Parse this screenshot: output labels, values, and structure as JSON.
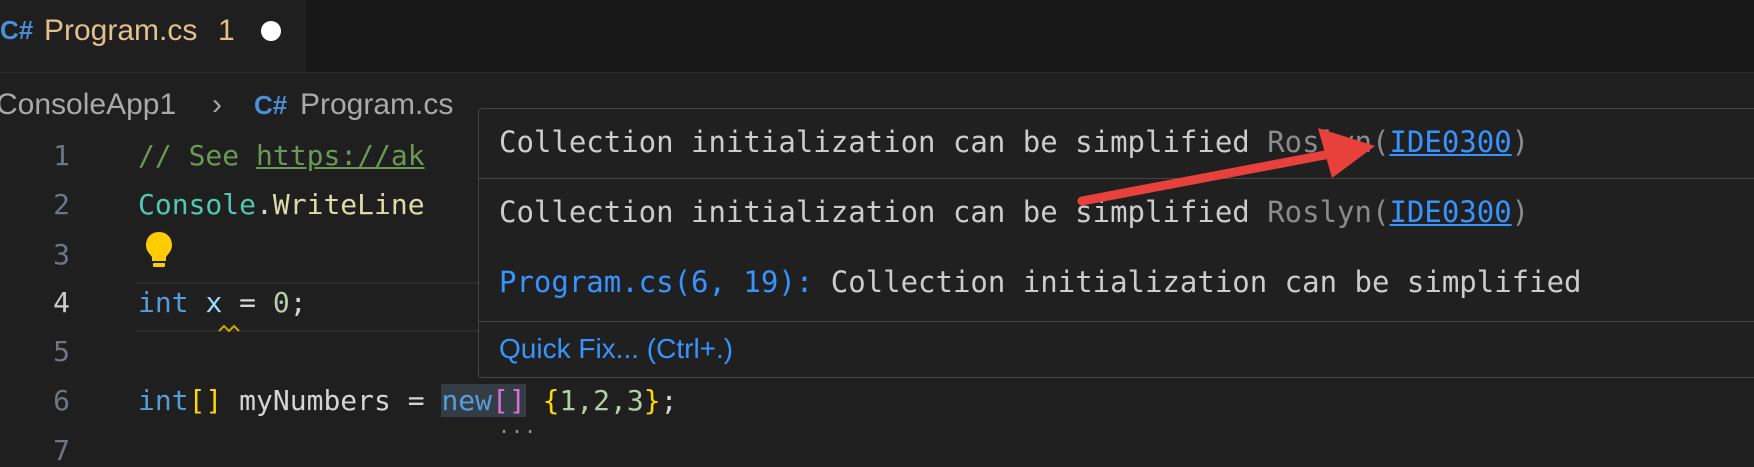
{
  "tab": {
    "icon": "csharp-file-icon",
    "title": "Program.cs",
    "badge": "1"
  },
  "breadcrumb": {
    "folder": "ConsoleApp1",
    "separator": "›",
    "file_icon": "csharp-file-icon",
    "file": "Program.cs"
  },
  "editor": {
    "line_numbers": [
      "1",
      "2",
      "3",
      "4",
      "5",
      "6",
      "7"
    ],
    "lines": {
      "l1_comment": "// See ",
      "l1_link": "https://ak",
      "l2_type": "Console",
      "l2_dot": ".",
      "l2_method": "WriteLine",
      "l4_kw": "int",
      "l4_var": "x",
      "l4_rest": " = ",
      "l4_num": "0",
      "l4_end": ";",
      "l6_kw": "int",
      "l6_brackets": "[]",
      "l6_name": " myNumbers = ",
      "l6_new": "new",
      "l6_new_brk": "[]",
      "l6_open": "{",
      "l6_vals": "1,2,3",
      "l6_close": "}",
      "l6_end": ";",
      "l6_dots": "..."
    }
  },
  "hover": {
    "message": "Collection initialization can be simplified ",
    "source": "Roslyn(",
    "code": "IDE0300",
    "source_close": ")",
    "location": "Program.cs(6, 19):",
    "location_message": " Collection initialization can be simplified",
    "quick_fix": "Quick Fix... (Ctrl+.)"
  },
  "colors": {
    "accent_link": "#3794ff",
    "tab_modified": "#e2c08d",
    "annotation_arrow": "#e8413c"
  }
}
